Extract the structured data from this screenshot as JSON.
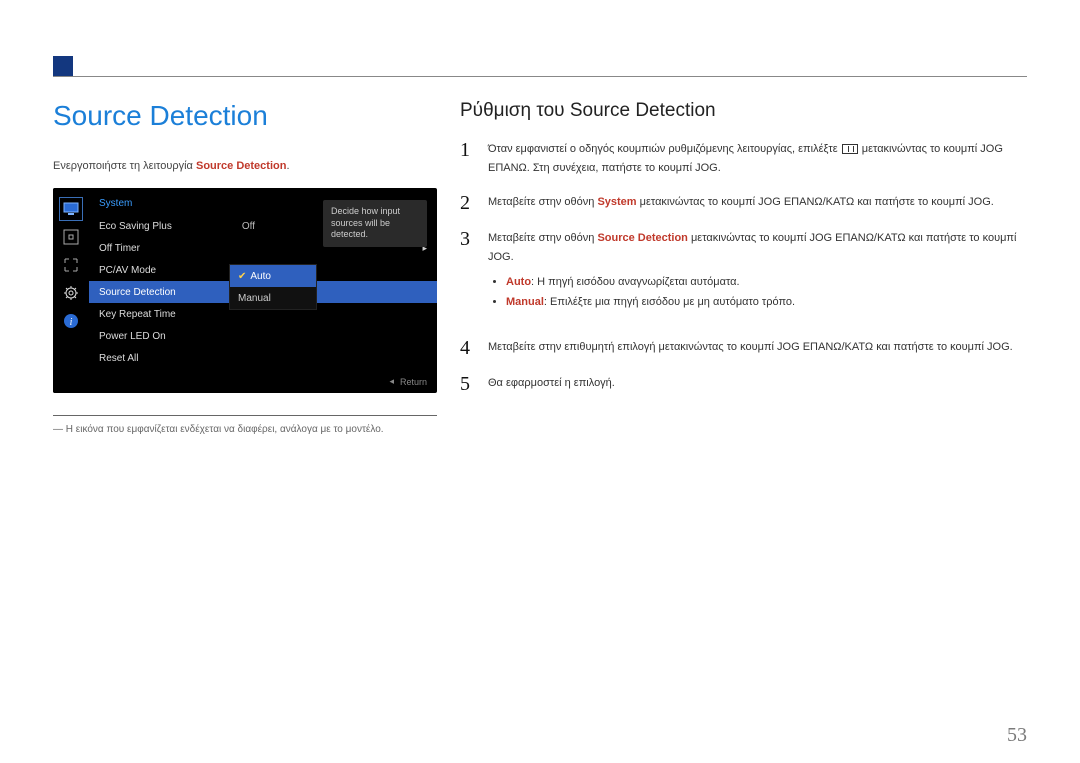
{
  "page": {
    "number": "53"
  },
  "left": {
    "title": "Source Detection",
    "intro_prefix": "Ενεργοποιήστε τη λειτουργία ",
    "intro_keyword": "Source Detection",
    "intro_suffix": ".",
    "footnote": "Η εικόνα που εμφανίζεται ενδέχεται να διαφέρει, ανάλογα με το μοντέλο."
  },
  "osd": {
    "section": "System",
    "tooltip": "Decide how input sources will be detected.",
    "items": [
      {
        "label": "Eco Saving Plus",
        "value": "Off"
      },
      {
        "label": "Off Timer"
      },
      {
        "label": "PC/AV Mode"
      },
      {
        "label": "Source Detection",
        "selected": true
      },
      {
        "label": "Key Repeat Time"
      },
      {
        "label": "Power LED On"
      },
      {
        "label": "Reset All"
      }
    ],
    "submenu": {
      "options": [
        {
          "label": "Auto",
          "active": true
        },
        {
          "label": "Manual"
        }
      ]
    },
    "return": "Return"
  },
  "right": {
    "title": "Ρύθμιση του Source Detection",
    "step1_a": "Όταν εμφανιστεί ο οδηγός κουμπιών ρυθμιζόμενης λειτουργίας, επιλέξτε ",
    "step1_b": " μετακινώντας το κουμπί JOG ΕΠΑΝΩ. Στη συνέχεια, πατήστε το κουμπί JOG.",
    "step2_a": "Μεταβείτε στην οθόνη ",
    "step2_kw": "System",
    "step2_b": " μετακινώντας το κουμπί JOG ΕΠΑΝΩ/ΚΑΤΩ και πατήστε το κουμπί JOG.",
    "step3_a": "Μεταβείτε στην οθόνη ",
    "step3_kw": "Source Detection",
    "step3_b": " μετακινώντας το κουμπί JOG ΕΠΑΝΩ/ΚΑΤΩ και πατήστε το κουμπί JOG.",
    "bullets": {
      "auto_kw": "Auto",
      "auto_text": ": Η πηγή εισόδου αναγνωρίζεται αυτόματα.",
      "manual_kw": "Manual",
      "manual_text": ": Επιλέξτε μια πηγή εισόδου με μη αυτόματο τρόπο."
    },
    "step4": "Μεταβείτε στην επιθυμητή επιλογή μετακινώντας το κουμπί JOG ΕΠΑΝΩ/ΚΑΤΩ και πατήστε το κουμπί JOG.",
    "step5": "Θα εφαρμοστεί η επιλογή."
  }
}
